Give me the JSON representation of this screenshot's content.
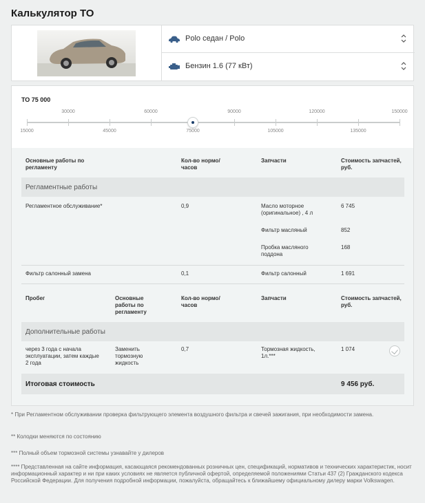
{
  "page": {
    "title": "Калькулятор ТО"
  },
  "selectors": {
    "model": {
      "value": "Polo седан / Polo",
      "icon": "car-icon"
    },
    "engine": {
      "value": "Бензин 1.6 (77 кВт)",
      "icon": "engine-icon"
    }
  },
  "mileage": {
    "label": "ТО 75 000",
    "selected_value": 75000,
    "top_ticks": [
      "30000",
      "60000",
      "90000",
      "120000",
      "150000"
    ],
    "bottom_ticks": [
      "15000",
      "45000",
      "75000",
      "105000",
      "135000"
    ]
  },
  "table1": {
    "headers": {
      "works": "Основные работы по регламенту",
      "hours": "Кол-во нормо/часов",
      "parts": "Запчасти",
      "cost": "Стоимость запчастей, руб."
    },
    "section": "Регламентные работы",
    "rows": [
      {
        "work": "Регламентное обслуживание*",
        "hours": "0,9",
        "part": "Масло моторное (оригинальное) , 4 л",
        "cost": "6 745"
      },
      {
        "work": "",
        "hours": "",
        "part": "Фильтр масляный",
        "cost": "852"
      },
      {
        "work": "",
        "hours": "",
        "part": "Пробка масляного поддона",
        "cost": "168"
      },
      {
        "work": "Фильтр салонный замена",
        "hours": "0,1",
        "part": "Фильтр салонный",
        "cost": "1 691"
      }
    ]
  },
  "table2": {
    "headers": {
      "mileage": "Пробег",
      "works": "Основные работы по регламенту",
      "hours": "Кол-во нормо/часов",
      "parts": "Запчасти",
      "cost": "Стоимость запчастей, руб."
    },
    "section": "Дополнительные работы",
    "rows": [
      {
        "mileage": "через 3 года с начала эксплуатации, затем каждые 2 года",
        "work": "Заменить тормозную жидкость",
        "hours": "0,7",
        "part": "Тормозная жидкость, 1л.***",
        "cost": "1 074"
      }
    ]
  },
  "total": {
    "label": "Итоговая стоимость",
    "value": "9 456 руб."
  },
  "notes": [
    "* При Регламентном обслуживании проверка фильтрующего элемента воздушного фильтра и свечей зажигания, при необходимости замена.",
    "** Колодки меняются по состоянию",
    "*** Полный объем тормозной системы узнавайте у дилеров",
    "**** Представленная на сайте информация, касающаяся рекомендованных розничных цен, спецификаций, нормативов и технических характеристик, носит информационный характер и ни при каких условиях не является публичной офертой, определяемой положениями Статьи 437 (2) Гражданского кодекса Российской Федерации. Для получения подробной информации, пожалуйста, обращайтесь к ближайшему официальному дилеру марки Volkswagen."
  ],
  "colors": {
    "accent": "#1b3f6b",
    "icon": "#3a5f8a",
    "section_bg": "#e3e6e6",
    "table_bg": "#f1f4f4"
  }
}
